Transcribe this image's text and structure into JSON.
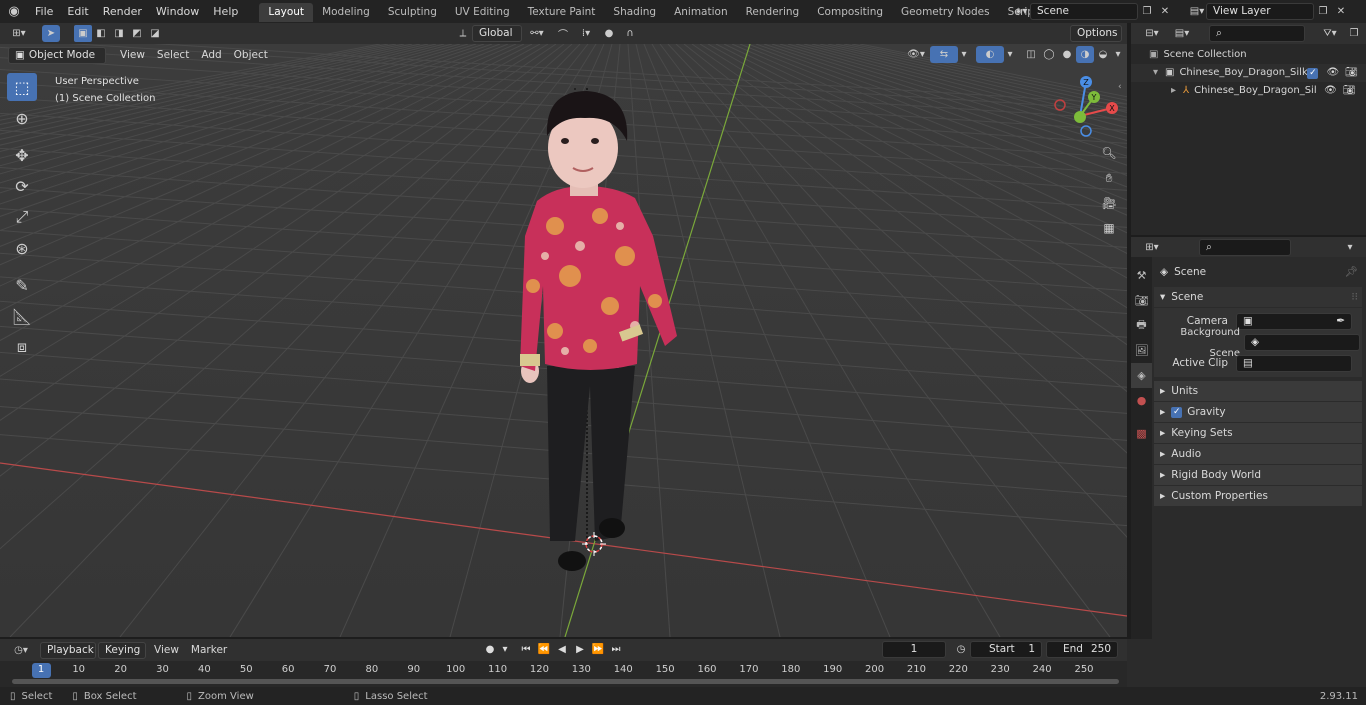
{
  "topbar": {
    "menus": [
      "File",
      "Edit",
      "Render",
      "Window",
      "Help"
    ],
    "workspaces": [
      "Layout",
      "Modeling",
      "Sculpting",
      "UV Editing",
      "Texture Paint",
      "Shading",
      "Animation",
      "Rendering",
      "Compositing",
      "Geometry Nodes",
      "Scripting"
    ],
    "active_workspace": "Layout",
    "scene_name": "Scene",
    "view_layer": "View Layer"
  },
  "viewport_header": {
    "mode": "Object Mode",
    "menus": [
      "View",
      "Select",
      "Add",
      "Object"
    ],
    "transform_orientation": "Global",
    "options_label": "Options"
  },
  "viewport": {
    "overlay_line1": "User Perspective",
    "overlay_line2": "(1) Scene Collection",
    "gizmo": {
      "x": "X",
      "y": "Y",
      "z": "Z"
    }
  },
  "outliner": {
    "root": "Scene Collection",
    "items": [
      {
        "label": "Chinese_Boy_Dragon_Silk_Cc",
        "level": 1
      },
      {
        "label": "Chinese_Boy_Dragon_Sil",
        "level": 2
      }
    ]
  },
  "properties": {
    "breadcrumb": "Scene",
    "section": "Scene",
    "fields": [
      {
        "label": "Camera",
        "value": ""
      },
      {
        "label": "Background Scene",
        "value": ""
      },
      {
        "label": "Active Clip",
        "value": ""
      }
    ],
    "panels": [
      "Units",
      "Gravity",
      "Keying Sets",
      "Audio",
      "Rigid Body World",
      "Custom Properties"
    ],
    "gravity_checked": true
  },
  "timeline": {
    "menus": [
      "Playback",
      "Keying",
      "View",
      "Marker"
    ],
    "current_frame": "1",
    "start_label": "Start",
    "start": "1",
    "end_label": "End",
    "end": "250",
    "ruler": [
      "1",
      "10",
      "20",
      "30",
      "40",
      "50",
      "60",
      "70",
      "80",
      "90",
      "100",
      "110",
      "120",
      "130",
      "140",
      "150",
      "160",
      "170",
      "180",
      "190",
      "200",
      "210",
      "220",
      "230",
      "240",
      "250"
    ]
  },
  "statusbar": {
    "select": "Select",
    "box_select": "Box Select",
    "zoom_view": "Zoom View",
    "lasso_select": "Lasso Select",
    "version": "2.93.11"
  },
  "colors": {
    "accent": "#4772b3",
    "x_axis": "#e64a4a",
    "y_axis": "#7dbb3a",
    "z_axis": "#4a8ee6"
  }
}
